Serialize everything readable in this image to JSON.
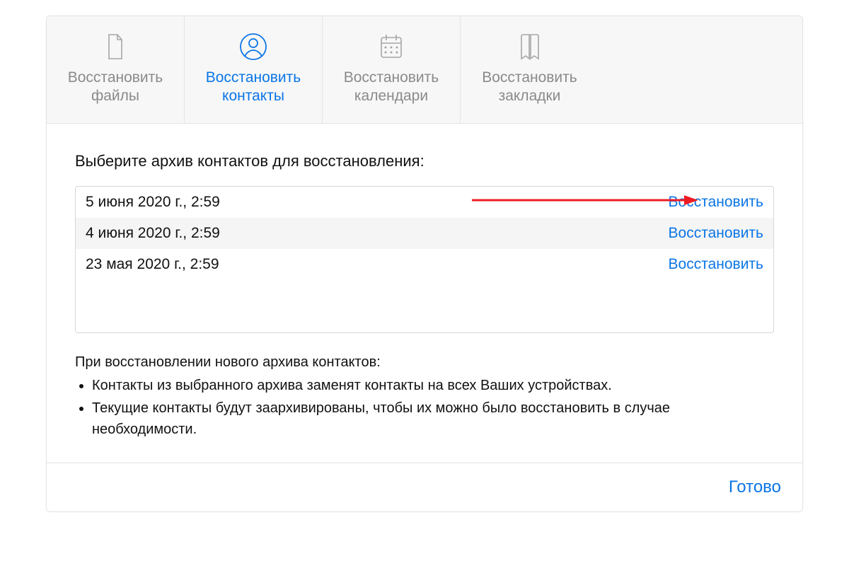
{
  "tabs": [
    {
      "id": "files",
      "label": "Восстановить\nфайлы",
      "active": false
    },
    {
      "id": "contacts",
      "label": "Восстановить\nконтакты",
      "active": true
    },
    {
      "id": "calendars",
      "label": "Восстановить\nкалендари",
      "active": false
    },
    {
      "id": "bookmarks",
      "label": "Восстановить\nзакладки",
      "active": false
    }
  ],
  "heading": "Выберите архив контактов для восстановления:",
  "archives": [
    {
      "date": "5 июня 2020 г., 2:59",
      "action": "Восстановить"
    },
    {
      "date": "4 июня 2020 г., 2:59",
      "action": "Восстановить"
    },
    {
      "date": "23 мая 2020 г., 2:59",
      "action": "Восстановить"
    }
  ],
  "notes": {
    "title": "При восстановлении нового архива контактов:",
    "items": [
      "Контакты из выбранного архива заменят контакты на всех Ваших устройствах.",
      "Текущие контакты будут заархивированы, чтобы их можно было восстановить в случае необходимости."
    ]
  },
  "footer": {
    "done": "Готово"
  },
  "colors": {
    "accent": "#0b75e6",
    "inactive": "#8a8a8a"
  }
}
